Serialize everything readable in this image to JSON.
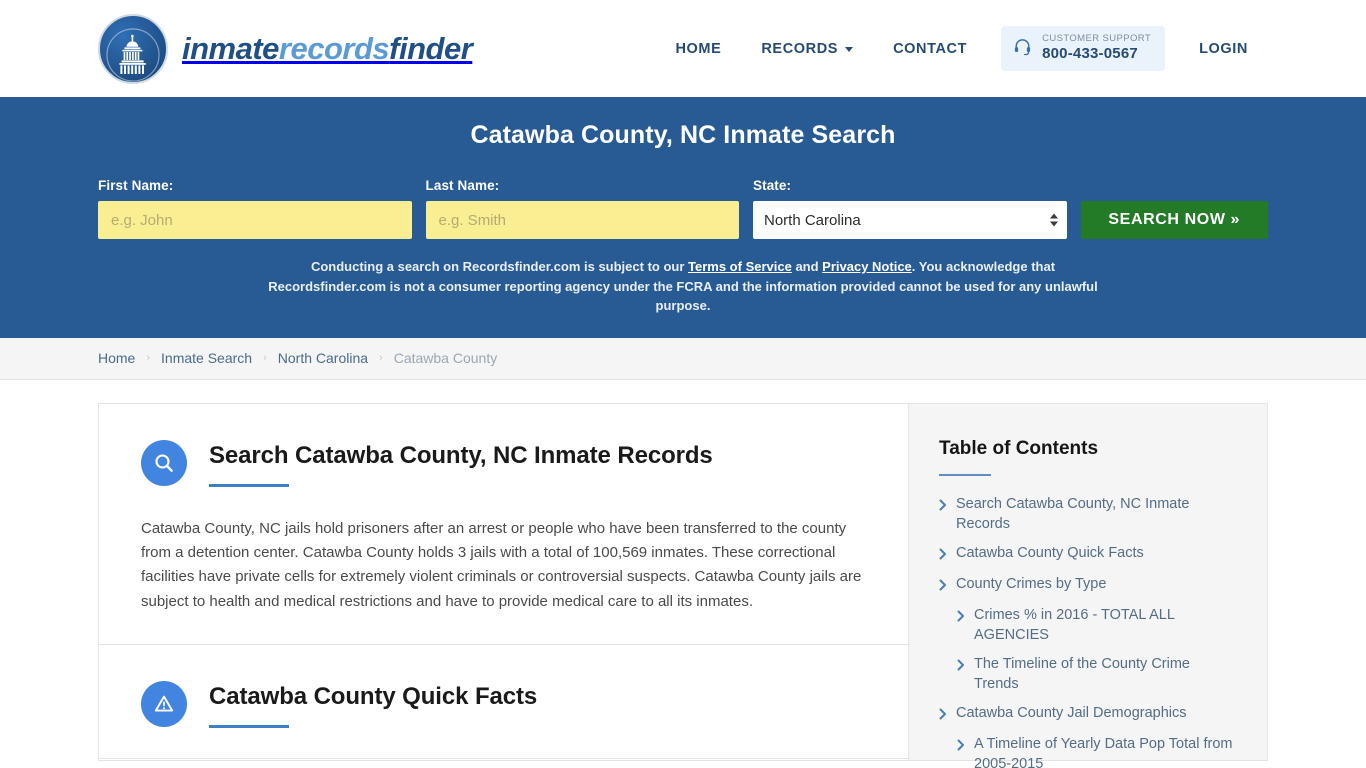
{
  "header": {
    "logo": {
      "icon": "capitol-dome-icon",
      "part1": "inmate",
      "part2": "records",
      "part3": "finder"
    },
    "nav": [
      {
        "label": "HOME",
        "name": "nav-home",
        "caret": false
      },
      {
        "label": "RECORDS",
        "name": "nav-records",
        "caret": true
      },
      {
        "label": "CONTACT",
        "name": "nav-contact",
        "caret": false
      }
    ],
    "support": {
      "icon": "headset-icon",
      "label": "CUSTOMER SUPPORT",
      "phone": "800-433-0567"
    },
    "login_label": "LOGIN"
  },
  "hero": {
    "title": "Catawba County, NC Inmate Search",
    "first_name_label": "First Name:",
    "first_name_value": "",
    "first_name_placeholder": "e.g. John",
    "last_name_label": "Last Name:",
    "last_name_value": "",
    "last_name_placeholder": "e.g. Smith",
    "state_label": "State:",
    "state_value": "North Carolina",
    "state_options": [
      "North Carolina"
    ],
    "search_button": "SEARCH NOW »",
    "disclaimer_pre": "Conducting a search on Recordsfinder.com is subject to our ",
    "disclaimer_link1": "Terms of Service",
    "disclaimer_mid": " and ",
    "disclaimer_link2": "Privacy Notice",
    "disclaimer_post": ". You acknowledge that Recordsfinder.com is not a consumer reporting agency under the FCRA and the information provided cannot be used for any unlawful purpose."
  },
  "breadcrumb": {
    "separator": "›",
    "items": [
      {
        "label": "Home",
        "current": false
      },
      {
        "label": "Inmate Search",
        "current": false
      },
      {
        "label": "North Carolina",
        "current": false
      },
      {
        "label": "Catawba County",
        "current": true
      }
    ]
  },
  "main": {
    "sections": [
      {
        "icon": "magnifier-icon",
        "title": "Search Catawba County, NC Inmate Records",
        "body": "Catawba County, NC jails hold prisoners after an arrest or people who have been transferred to the county from a detention center. Catawba County holds 3 jails with a total of 100,569 inmates. These correctional facilities have private cells for extremely violent criminals or controversial suspects. Catawba County jails are subject to health and medical restrictions and have to provide medical care to all its inmates."
      },
      {
        "icon": "warning-triangle-icon",
        "title": "Catawba County Quick Facts",
        "body": ""
      }
    ]
  },
  "sidebar": {
    "title": "Table of Contents",
    "items": [
      {
        "label": "Search Catawba County, NC Inmate Records",
        "level": 1
      },
      {
        "label": "Catawba County Quick Facts",
        "level": 1
      },
      {
        "label": "County Crimes by Type",
        "level": 1
      },
      {
        "label": "Crimes % in 2016 - TOTAL ALL AGENCIES",
        "level": 2
      },
      {
        "label": "The Timeline of the County Crime Trends",
        "level": 2
      },
      {
        "label": "Catawba County Jail Demographics",
        "level": 1
      },
      {
        "label": "A Timeline of Yearly Data Pop Total from 2005-2015",
        "level": 2
      }
    ]
  },
  "colors": {
    "banner_blue": "#285a93",
    "accent_blue": "#4285e0",
    "input_yellow": "#faee92",
    "button_green": "#237a27",
    "sidebar_gray": "#f5f5f5"
  }
}
